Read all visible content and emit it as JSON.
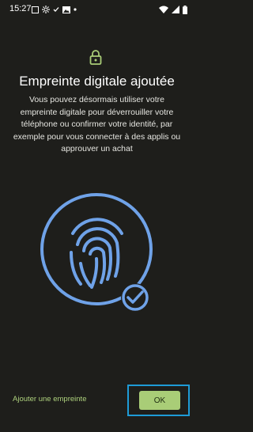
{
  "status_bar": {
    "time": "15:27",
    "left_icons": [
      "screenshot-icon",
      "settings-gear-icon",
      "check-notification-icon",
      "image-icon",
      "dot-icon"
    ],
    "right_icons": [
      "wifi-icon",
      "signal-icon",
      "battery-icon"
    ]
  },
  "header": {
    "icon": "lock-icon",
    "title": "Empreinte digitale ajoutée"
  },
  "body": {
    "description": "Vous pouvez désormais utiliser votre empreinte digitale pour déverrouiller votre téléphone ou confirmer votre identité, par exemple pour vous connecter à des applis ou approuver un achat"
  },
  "illustration": {
    "icon": "fingerprint-success-icon",
    "accent_color": "#6fa2e8"
  },
  "footer": {
    "add_fingerprint_label": "Ajouter une empreinte",
    "ok_label": "OK"
  },
  "colors": {
    "background": "#1e1e1b",
    "accent_green": "#a9cd77",
    "link_green": "#aed17d",
    "highlight_blue": "#1e9bd7"
  }
}
